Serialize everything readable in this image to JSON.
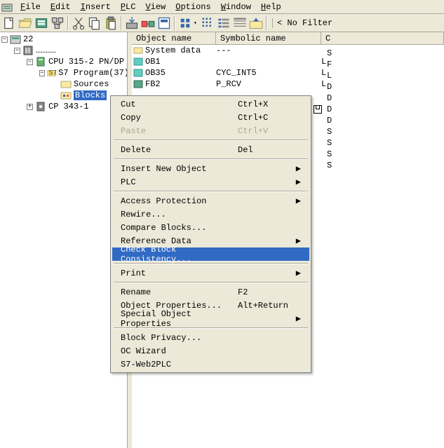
{
  "menu": {
    "items": [
      "File",
      "Edit",
      "Insert",
      "PLC",
      "View",
      "Options",
      "Window",
      "Help"
    ]
  },
  "toolbar": {
    "filter_label": "< No Filter"
  },
  "tree": {
    "root": "22",
    "station_partial": "…………",
    "cpu": "CPU 315-2 PN/DP",
    "program": "S7 Program(37)",
    "sources": "Sources",
    "blocks": "Blocks",
    "cp": "CP 343-1"
  },
  "list": {
    "headers": [
      "Object name",
      "Symbolic name",
      "C"
    ],
    "rows": [
      {
        "name": "System data",
        "sym": "---",
        "c": ""
      },
      {
        "name": "OB1",
        "sym": "",
        "c": "L"
      },
      {
        "name": "OB35",
        "sym": "CYC_INT5",
        "c": "L"
      },
      {
        "name": "FB2",
        "sym": "P_RCV",
        "c": "L"
      }
    ],
    "cut_col": [
      "S",
      "F",
      "L",
      "D",
      "D",
      "D",
      "D",
      "S",
      "S",
      "S",
      "S"
    ]
  },
  "ctx": {
    "cut": "Cut",
    "cut_sc": "Ctrl+X",
    "copy": "Copy",
    "copy_sc": "Ctrl+C",
    "paste": "Paste",
    "paste_sc": "Ctrl+V",
    "delete": "Delete",
    "delete_sc": "Del",
    "insert_new": "Insert New Object",
    "plc": "PLC",
    "access": "Access Protection",
    "rewire": "Rewire...",
    "compare": "Compare Blocks...",
    "refdata": "Reference Data",
    "check": "Check Block Consistency...",
    "print": "Print",
    "rename": "Rename",
    "rename_sc": "F2",
    "objprop": "Object Properties...",
    "objprop_sc": "Alt+Return",
    "special": "Special Object Properties",
    "privacy": "Block Privacy...",
    "oc": "OC Wizard",
    "web2plc": "S7-Web2PLC"
  }
}
